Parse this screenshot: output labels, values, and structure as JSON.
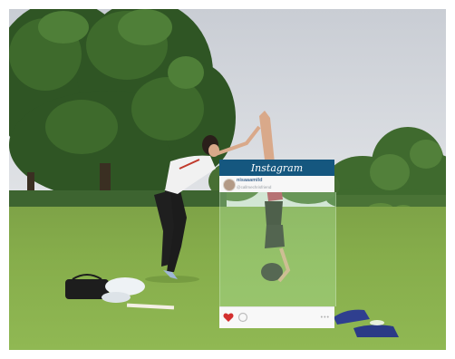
{
  "instagram": {
    "logo": "Instagram",
    "username": "nisaaamild",
    "subtitle": "@callmechrisfriend",
    "menu_dots": "•••"
  },
  "colors": {
    "header": "#15577f",
    "grass": "#86ad4b",
    "heart": "#d32f2f"
  }
}
